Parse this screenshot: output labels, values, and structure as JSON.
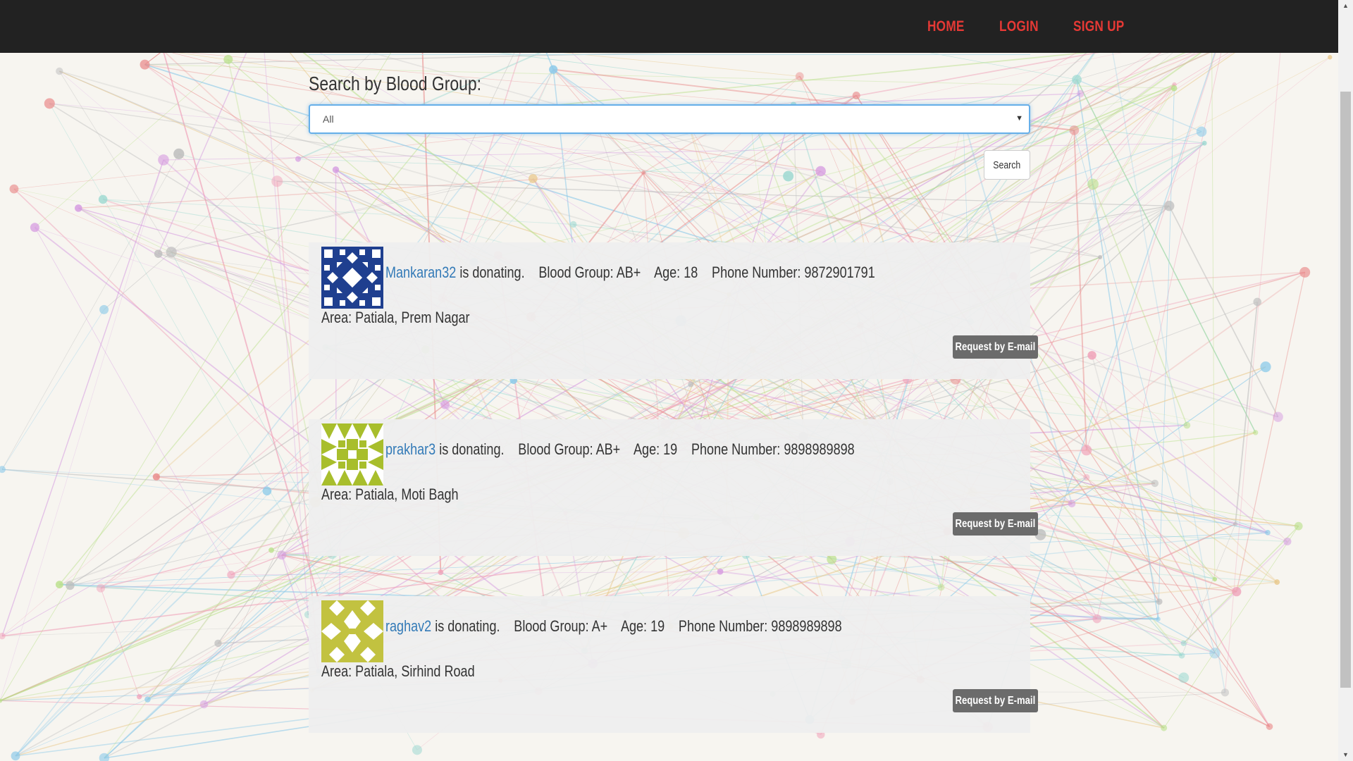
{
  "nav": {
    "items": [
      {
        "label": "HOME"
      },
      {
        "label": "LOGIN"
      },
      {
        "label": "SIGN UP"
      }
    ]
  },
  "search": {
    "label": "Search by Blood Group:",
    "selected": "All",
    "button_label": "Search"
  },
  "donors": [
    {
      "username": "Mankaran32",
      "status": "is donating.",
      "blood_group": "Blood Group: AB+",
      "age": "Age: 18",
      "phone": "Phone Number: 9872901791",
      "area": "Area: Patiala, Prem Nagar",
      "button_label": "Request by E-mail",
      "avatar_color": "#1f3f8f"
    },
    {
      "username": "prakhar3",
      "status": "is donating.",
      "blood_group": "Blood Group: AB+",
      "age": "Age: 19",
      "phone": "Phone Number: 9898989898",
      "area": "Area: Patiala, Moti Bagh",
      "button_label": "Request by E-mail",
      "avatar_color": "#a8be2c"
    },
    {
      "username": "raghav2",
      "status": "is donating.",
      "blood_group": "Blood Group: A+",
      "age": "Age: 19",
      "phone": "Phone Number: 9898989898",
      "area": "Area: Patiala, Sirhind Road",
      "button_label": "Request by E-mail",
      "avatar_color": "#c2c240"
    }
  ],
  "theme": {
    "nav_bg": "#222222",
    "nav_link": "#e53935",
    "link": "#337ab7",
    "card_bg": "#eeeeee",
    "button_bg": "#6b6b6b"
  }
}
